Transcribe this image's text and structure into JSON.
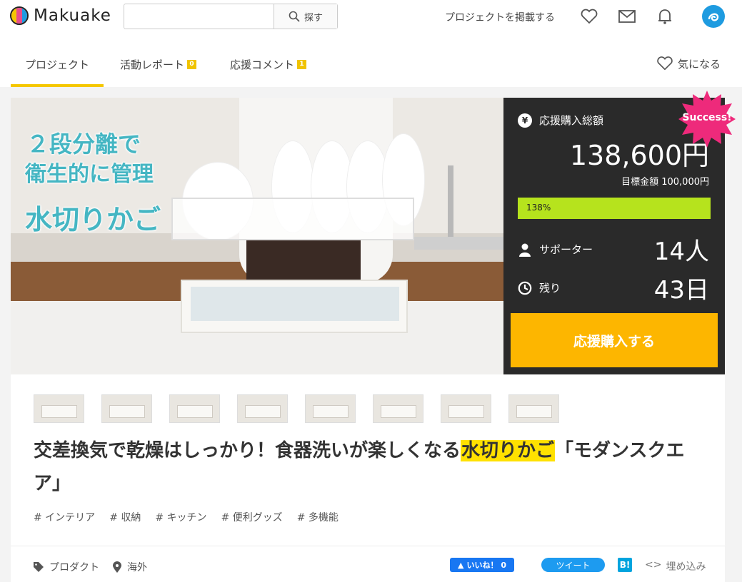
{
  "brand": {
    "logo_text": "Makuake",
    "logo_colors": [
      "#f5c700",
      "#e84e8a",
      "#1e9be0"
    ]
  },
  "header": {
    "search_placeholder": "",
    "search_button": "探す",
    "post_project": "プロジェクトを掲載する",
    "icons": [
      "heart-icon",
      "mail-icon",
      "bell-icon",
      "user-avatar"
    ]
  },
  "tabs": [
    {
      "label": "プロジェクト",
      "badge": ""
    },
    {
      "label": "活動レポート",
      "badge": "0"
    },
    {
      "label": "応援コメント",
      "badge": "1"
    }
  ],
  "favorite": "気になる",
  "hero": {
    "line1": "２段分離で",
    "line2": "衛生的に管理",
    "line3": "水切りかご"
  },
  "panel": {
    "total_label": "応援購入総額",
    "total_amount": "138,600円",
    "goal": "目標金額 100,000円",
    "progress_text": "138%",
    "progress_fraction": 1.0,
    "supporters_label": "サポーター",
    "supporters_value": "14人",
    "remaining_label": "残り",
    "remaining_value": "43日",
    "cta": "応援購入する",
    "status_badge": "Success!",
    "accent": "#fdb600",
    "bar_color": "#b6e31d"
  },
  "thumbnails_count": 8,
  "project": {
    "title_before": "交差換気で乾燥はしっかり！食器洗いが楽しくなる",
    "title_highlight": "水切りかご",
    "title_after": "「モダンスクエア」",
    "tags": [
      "# インテリア",
      "# 収納",
      "# キッチン",
      "# 便利グッズ",
      "# 多機能"
    ]
  },
  "meta": {
    "category": "プロダクト",
    "location": "海外"
  },
  "share": {
    "like": "いいね！ 0",
    "tweet": "ツイート",
    "hatena": "B!",
    "embed": "埋め込み"
  }
}
